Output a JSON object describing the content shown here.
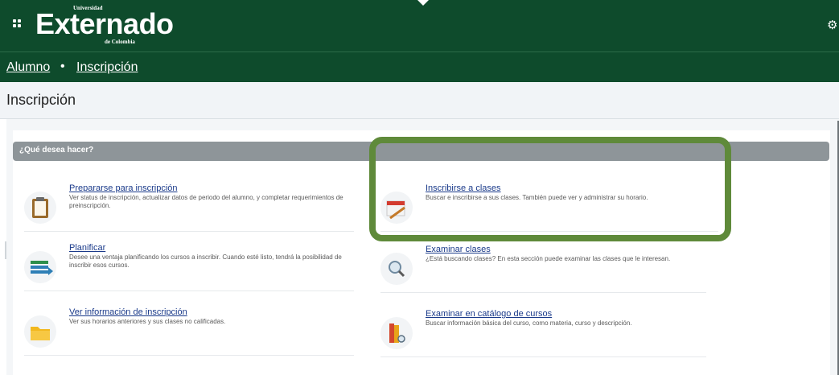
{
  "header": {
    "logo_top": "Universidad",
    "logo_main": "Externado",
    "logo_bottom": "de Colombia"
  },
  "breadcrumb": {
    "item1": "Alumno",
    "separator": "•",
    "item2": "Inscripción"
  },
  "page": {
    "title": "Inscripción"
  },
  "panel": {
    "title": "¿Qué desea hacer?",
    "items": [
      {
        "label": "Prepararse para inscripción",
        "description": "Ver status de inscripción, actualizar datos de periodo del alumno, y completar requerimientos de preinscripción.",
        "icon": "clipboard-icon"
      },
      {
        "label": "Inscribirse a clases",
        "description": "Buscar e inscribirse a sus clases. También puede ver y administrar su horario.",
        "icon": "calendar-pencil-icon"
      },
      {
        "label": "Planificar",
        "description": "Desee una ventaja planificando los cursos a inscribir. Cuando esté listo, tendrá la posibilidad de inscribir esos cursos.",
        "icon": "list-plan-icon"
      },
      {
        "label": "Examinar clases",
        "description": "¿Está buscando clases? En esta sección puede examinar las clases que le interesan.",
        "icon": "magnifier-icon"
      },
      {
        "label": "Ver información de inscripción",
        "description": "Ver sus horarios anteriores y sus clases no calificadas.",
        "icon": "folder-icon"
      },
      {
        "label": "Examinar en catálogo de cursos",
        "description": "Buscar información básica del curso, como materia, curso y descripción.",
        "icon": "catalog-books-icon"
      }
    ]
  },
  "colors": {
    "header_green": "#0e4b2c",
    "highlight_green": "#5f8a3a",
    "link_blue": "#1a3a8a",
    "panel_header_gray": "#8e9599"
  }
}
